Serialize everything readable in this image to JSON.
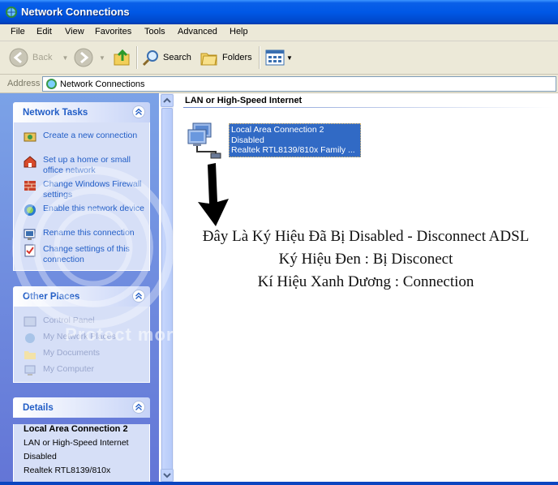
{
  "window": {
    "title": "Network Connections"
  },
  "menu": [
    "File",
    "Edit",
    "View",
    "Favorites",
    "Tools",
    "Advanced",
    "Help"
  ],
  "toolbar": {
    "back": "Back",
    "search": "Search",
    "folders": "Folders"
  },
  "address": {
    "label": "Address",
    "value": "Network Connections"
  },
  "network_tasks": {
    "title": "Network Tasks",
    "items": [
      {
        "label": "Create a new connection",
        "icon": "new-connection-icon"
      },
      {
        "label": "Set up a home or small office network",
        "icon": "home-network-icon"
      },
      {
        "label": "Change Windows Firewall settings",
        "icon": "firewall-icon"
      },
      {
        "label": "Enable this network device",
        "icon": "enable-device-icon"
      },
      {
        "label": "Rename this connection",
        "icon": "rename-icon"
      },
      {
        "label": "Change settings of this connection",
        "icon": "settings-icon"
      }
    ]
  },
  "other_places": {
    "title": "Other Places",
    "items": [
      {
        "label": "Control Panel",
        "icon": "control-panel-icon"
      },
      {
        "label": "My Network Places",
        "icon": "network-places-icon"
      },
      {
        "label": "My Documents",
        "icon": "documents-folder-icon"
      },
      {
        "label": "My Computer",
        "icon": "computer-icon"
      }
    ]
  },
  "details": {
    "title": "Details",
    "name": "Local Area Connection 2",
    "type": "LAN or High-Speed Internet",
    "status": "Disabled",
    "device": "Realtek RTL8139/810x"
  },
  "content": {
    "group_header": "LAN or High-Speed Internet",
    "connection": {
      "name": "Local Area Connection 2",
      "status": "Disabled",
      "device": "Realtek RTL8139/810x Family ..."
    },
    "annotation": [
      "Đây Là Ký Hiệu Đã Bị Disabled - Disconnect ADSL",
      "Ký Hiệu Đen : Bị Disconect",
      "Kí Hiệu Xanh Dương : Connection"
    ]
  },
  "watermark": "Protect more",
  "colors": {
    "titlebar": "#0058e6",
    "task_link": "#215dc6",
    "selection": "#316ac5",
    "leftpane": "#7ba2e7"
  }
}
